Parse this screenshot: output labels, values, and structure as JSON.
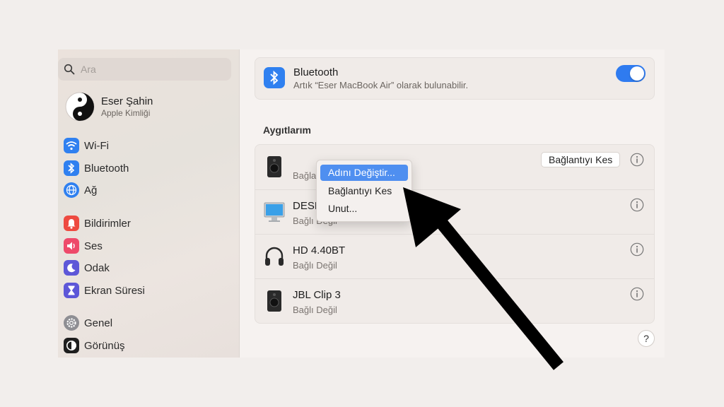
{
  "sidebar": {
    "search_placeholder": "Ara",
    "profile": {
      "name": "Eser Şahin",
      "subtitle": "Apple Kimliği"
    },
    "items": [
      {
        "label": "Wi-Fi",
        "icon": "wifi-icon",
        "color": "#2f80f0"
      },
      {
        "label": "Bluetooth",
        "icon": "bluetooth-icon",
        "color": "#2f80f0"
      },
      {
        "label": "Ağ",
        "icon": "globe-icon",
        "color": "#2f80f0"
      },
      {
        "label": "Bildirimler",
        "icon": "bell-icon",
        "color": "#ee4a40"
      },
      {
        "label": "Ses",
        "icon": "speaker-icon",
        "color": "#ee4a6a"
      },
      {
        "label": "Odak",
        "icon": "moon-icon",
        "color": "#5d57d8"
      },
      {
        "label": "Ekran Süresi",
        "icon": "hourglass-icon",
        "color": "#5d57d8"
      },
      {
        "label": "Genel",
        "icon": "gear-icon",
        "color": "#8e8e93"
      },
      {
        "label": "Görünüş",
        "icon": "appearance-icon",
        "color": "#1e1e1e"
      }
    ]
  },
  "bluetooth": {
    "title": "Bluetooth",
    "subtitle": "Artık “Eser MacBook Air” olarak bulunabilir.",
    "enabled": true,
    "accent": "#2f7bf0"
  },
  "devices": {
    "section_title": "Aygıtlarım",
    "list": [
      {
        "name": "",
        "status": "Bağla",
        "icon": "speaker-device-icon"
      },
      {
        "name": "DESK",
        "status": "Bağlı Değil",
        "icon": "monitor-icon"
      },
      {
        "name": "HD 4.40BT",
        "status": "Bağlı Değil",
        "icon": "headphones-icon"
      },
      {
        "name": "JBL Clip 3",
        "status": "Bağlı Değil",
        "icon": "speaker-device-icon"
      }
    ],
    "disconnect_button": "Bağlantıyı Kes"
  },
  "context_menu": {
    "items": [
      "Adını Değiştir...",
      "Bağlantıyı Kes",
      "Unut..."
    ],
    "highlight_color": "#4f8ff0"
  },
  "help_label": "?"
}
